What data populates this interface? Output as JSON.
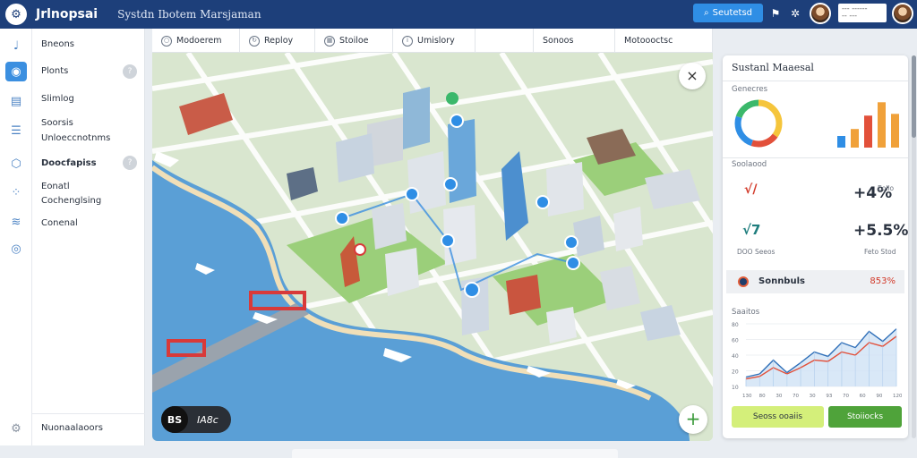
{
  "header": {
    "brand": "Jrlnopsai",
    "subtitle": "Systdn Ibotem Marsjaman",
    "search_button": "Seutetsd",
    "notif_icon": "flag-icon",
    "settings_icon": "gear-icon",
    "field_line1": "--- ------",
    "field_line2": "-- ---"
  },
  "sidebar": {
    "rail_icons": [
      "chart-icon",
      "map-pin-icon",
      "document-icon",
      "list-icon",
      "cube-icon",
      "dots-icon",
      "layers-icon",
      "globe-icon"
    ],
    "items": [
      {
        "label": "Bneons"
      },
      {
        "label": "Plonts",
        "badge": "?"
      },
      {
        "label": "Slimlog"
      },
      {
        "label": "Soorsis"
      },
      {
        "label": "Unloeccnotnms"
      },
      {
        "label": "Doocfapiss",
        "badge": "?"
      },
      {
        "label": "Eonatl"
      },
      {
        "label": "Cochenglsing"
      },
      {
        "label": "Conenal"
      }
    ],
    "footer_label": "Nuonaalaoors"
  },
  "toolbar": {
    "tabs": [
      {
        "label": "Modoerem"
      },
      {
        "label": "Reploy"
      },
      {
        "label": "Stoiloe"
      },
      {
        "label": "Umislory"
      },
      {
        "label": "Sonoos"
      },
      {
        "label": "Motoooctsc"
      }
    ]
  },
  "map": {
    "close_label": "×",
    "add_label": "+",
    "pill_a": "BS",
    "pill_b": "IA8c"
  },
  "panel": {
    "title": "Sustanl Maaesal",
    "section1": "Genecres",
    "section2": "Soolaood",
    "stats": [
      {
        "big": "+4%",
        "small": "Eollo",
        "color": "#4fa33a"
      },
      {
        "big": "+5.5%",
        "small": "Feto Stod",
        "color": "#4fa33a"
      }
    ],
    "stat_icon_1": "√/",
    "stat_icon_2": "√7",
    "stat_label_2": "DOO Seeos",
    "row_label": "Sonnbuls",
    "row_value": "853%",
    "section3": "Saaitos",
    "chart_ticks_y": [
      "80",
      "60",
      "40",
      "20",
      "10"
    ],
    "chart_ticks_x": [
      "130",
      "80",
      "30",
      "70",
      "30",
      "93",
      "70",
      "60",
      "90",
      "120"
    ],
    "btn_a": "Seoss ooaiis",
    "btn_b": "Stoiiocks"
  },
  "colors": {
    "header": "#1d3f7a",
    "accent": "#3b8fe0",
    "green": "#4fa33a",
    "lime": "#d4ef7a",
    "red": "#d23a2a"
  },
  "chart_data": [
    {
      "type": "pie",
      "values": [
        35,
        20,
        25,
        20
      ],
      "colors": [
        "#f5c53b",
        "#e2503a",
        "#2f8ee5",
        "#3bb86b"
      ]
    },
    {
      "type": "bar",
      "values": [
        20,
        32,
        55,
        78,
        58
      ],
      "colors": [
        "#2f8ee5",
        "#f0a13a",
        "#e2503a",
        "#f0a13a",
        "#f0a13a"
      ]
    },
    {
      "type": "area",
      "series": [
        {
          "values": [
            15,
            20,
            42,
            22,
            38,
            55,
            48,
            70,
            62,
            88,
            72,
            92
          ]
        },
        {
          "values": [
            12,
            16,
            30,
            20,
            30,
            42,
            40,
            55,
            50,
            70,
            64,
            80
          ]
        }
      ],
      "ylim": [
        0,
        100
      ]
    }
  ]
}
